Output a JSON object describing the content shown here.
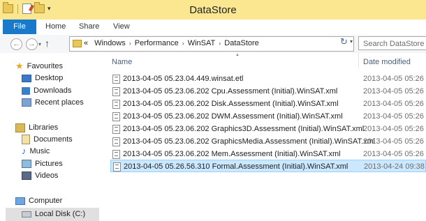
{
  "window": {
    "title": "DataStore"
  },
  "ribbon": {
    "tabs": [
      "File",
      "Home",
      "Share",
      "View"
    ]
  },
  "address": {
    "overflow": "«",
    "crumbs": [
      "Windows",
      "Performance",
      "WinSAT",
      "DataStore"
    ],
    "search_placeholder": "Search DataStore"
  },
  "columns": {
    "name": "Name",
    "date": "Date modified"
  },
  "sidebar": {
    "favourites": {
      "label": "Favourites",
      "items": [
        "Desktop",
        "Downloads",
        "Recent places"
      ]
    },
    "libraries": {
      "label": "Libraries",
      "items": [
        "Documents",
        "Music",
        "Pictures",
        "Videos"
      ]
    },
    "computer": {
      "label": "Computer",
      "items": [
        "Local Disk (C:)"
      ]
    }
  },
  "files": [
    {
      "name": "2013-04-05 05.23.04.449.winsat.etl",
      "date": ""
    },
    {
      "name": "2013-04-05 05.23.06.202 Cpu.Assessment (Initial).WinSAT.xml",
      "date": "2013-04-05 05:26 ..."
    },
    {
      "name": "2013-04-05 05.23.06.202 Disk.Assessment (Initial).WinSAT.xml",
      "date": "2013-04-05 05:26 ..."
    },
    {
      "name": "2013-04-05 05.23.06.202 DWM.Assessment (Initial).WinSAT.xml",
      "date": "2013-04-05 05:26 ..."
    },
    {
      "name": "2013-04-05 05.23.06.202 Graphics3D.Assessment (Initial).WinSAT.xml",
      "date": "2013-04-05 05:26 ..."
    },
    {
      "name": "2013-04-05 05.23.06.202 GraphicsMedia.Assessment (Initial).WinSAT.xml",
      "date": "2013-04-05 05:26 ..."
    },
    {
      "name": "2013-04-05 05.23.06.202 Mem.Assessment (Initial).WinSAT.xml",
      "date": "2013-04-05 05:26 ..."
    },
    {
      "name": "2013-04-05 05.26.56.310 Formal.Assessment (Initial).WinSAT.xml",
      "date": "2013-04-24 09:38 ..."
    }
  ],
  "first_row_date": "2013-04-05 05:26 ...",
  "selected_file_index": 7,
  "colors": {
    "title_bar": "#fbe78f",
    "file_tab": "#1979ca",
    "selection": "#cce8ff"
  }
}
